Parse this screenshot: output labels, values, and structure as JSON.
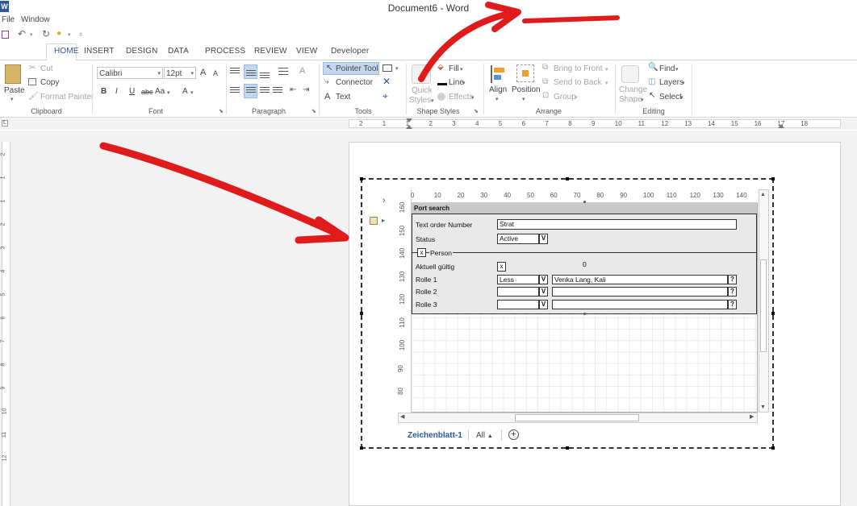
{
  "window": {
    "title": "Document6 - Word",
    "app_icon": "word-icon"
  },
  "menubar": [
    "File",
    "Window"
  ],
  "ribbon_tabs": [
    "HOME",
    "INSERT",
    "DESIGN",
    "DATA",
    "PROCESS",
    "REVIEW",
    "VIEW",
    "Developer"
  ],
  "active_tab": "HOME",
  "clipboard": {
    "paste": "Paste",
    "cut": "Cut",
    "copy": "Copy",
    "format_painter": "Format Painter",
    "label": "Clipboard"
  },
  "font": {
    "name": "Calibri",
    "size": "12pt",
    "bold": "B",
    "italic": "I",
    "underline": "U",
    "strike": "abc",
    "case": "Aa",
    "color": "A",
    "grow": "A",
    "shrink": "A",
    "label": "Font"
  },
  "paragraph": {
    "label": "Paragraph"
  },
  "tools": {
    "pointer": "Pointer Tool",
    "connector": "Connector",
    "text": "Text",
    "label": "Tools"
  },
  "shape_styles": {
    "quick": "Quick",
    "styles": "Styles",
    "fill": "Fill",
    "line": "Line",
    "effects": "Effects",
    "label": "Shape Styles"
  },
  "arrange": {
    "align": "Align",
    "position": "Position",
    "bring_front": "Bring to Front",
    "send_back": "Send to Back",
    "group": "Group",
    "label": "Arrange"
  },
  "editing": {
    "change_shape": "Change",
    "shape": "Shape",
    "find": "Find",
    "layers": "Layers",
    "select": "Select",
    "label": "Editing"
  },
  "hruler": [
    "2",
    "1",
    "1",
    "2",
    "3",
    "4",
    "5",
    "6",
    "7",
    "8",
    "9",
    "10",
    "11",
    "12",
    "13",
    "14",
    "15",
    "16",
    "17",
    "18"
  ],
  "vruler": [
    "2",
    "1",
    "1",
    "2",
    "3",
    "4",
    "5",
    "6",
    "7",
    "8",
    "9",
    "10",
    "11",
    "12"
  ],
  "canvas": {
    "top_ruler": [
      "0",
      "10",
      "20",
      "30",
      "40",
      "50",
      "60",
      "70",
      "80",
      "90",
      "100",
      "110",
      "120",
      "130",
      "140",
      "1"
    ],
    "left_ruler": [
      "160",
      "150",
      "140",
      "130",
      "120",
      "110",
      "100",
      "90",
      "80"
    ]
  },
  "form": {
    "title": "Port search",
    "text_order_label": "Text order Number",
    "text_order_value": "Strat",
    "status_label": "Status",
    "status_value": "Active",
    "dropdown_btn": "V",
    "person_check": "x",
    "person_label": "Person",
    "aktuell_label": "Aktuell gültig",
    "aktuell_check": "x",
    "counter": "0",
    "help_btn": "?",
    "roles": [
      {
        "label": "Rolle 1",
        "type": "Less",
        "person": "Venka Lang, Kali"
      },
      {
        "label": "Rolle 2",
        "type": "",
        "person": ""
      },
      {
        "label": "Rolle 3",
        "type": "",
        "person": ""
      }
    ]
  },
  "sheet": {
    "name": "Zeichenblatt-1",
    "all": "All",
    "add": "+"
  },
  "annotation_color": "#e01b1b"
}
